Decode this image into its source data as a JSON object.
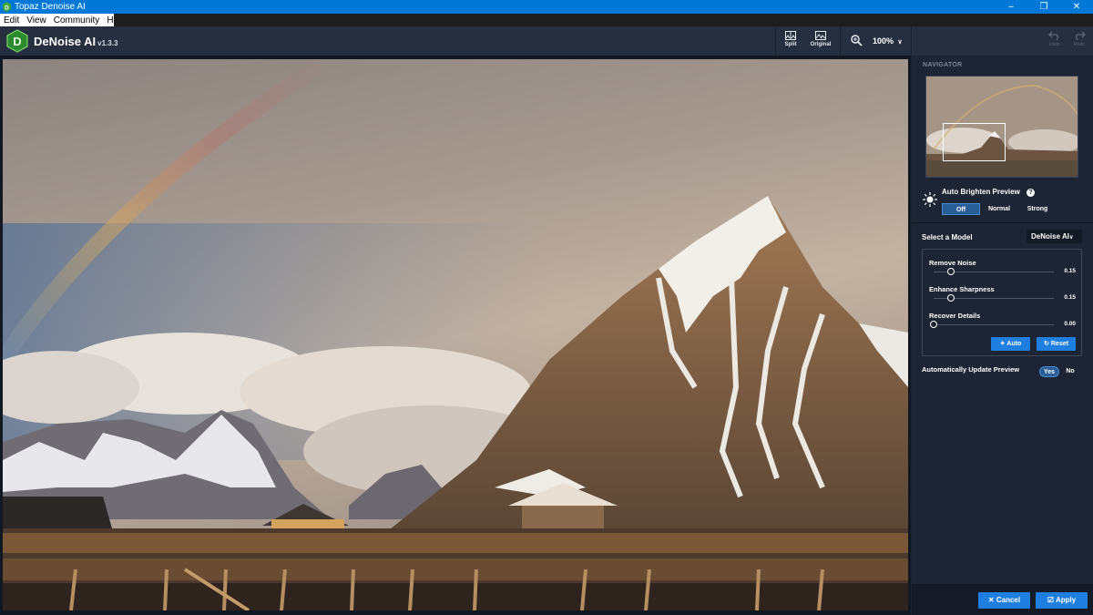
{
  "window": {
    "title": "Topaz Denoise AI"
  },
  "menu": [
    "Edit",
    "View",
    "Community",
    "Help"
  ],
  "app": {
    "name": "DeNoise AI",
    "version": "v1.3.3",
    "accent": "#1f7fe0"
  },
  "toolbar": {
    "split_label": "Split",
    "original_label": "Original",
    "zoom_value": "100%",
    "undo_label": "Undo",
    "redo_label": "Redo"
  },
  "navigator": {
    "caption": "NAVIGATOR"
  },
  "auto_brighten": {
    "title": "Auto Brighten Preview",
    "options": [
      "Off",
      "Normal",
      "Strong"
    ],
    "selected": "Off"
  },
  "model": {
    "label": "Select a Model",
    "value": "DeNoise AI"
  },
  "sliders": [
    {
      "label": "Remove Noise",
      "value": "0.15",
      "fraction": 0.15
    },
    {
      "label": "Enhance Sharpness",
      "value": "0.15",
      "fraction": 0.15
    },
    {
      "label": "Recover Details",
      "value": "0.00",
      "fraction": 0.0
    }
  ],
  "actions": {
    "auto_label": "Auto",
    "reset_label": "Reset"
  },
  "auto_update": {
    "label": "Automatically Update Preview",
    "yes": "Yes",
    "no": "No",
    "selected": "Yes"
  },
  "footer": {
    "cancel_label": "Cancel",
    "apply_label": "Apply"
  }
}
